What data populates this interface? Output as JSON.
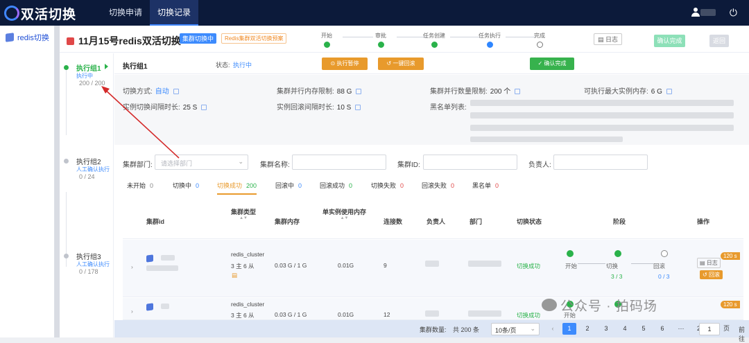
{
  "app": {
    "title": "双活切换"
  },
  "topnav": {
    "tabs": [
      {
        "label": "切换申请"
      },
      {
        "label": "切换记录"
      }
    ]
  },
  "sidebar": {
    "items": [
      {
        "label": "redis切换"
      }
    ]
  },
  "header": {
    "title": "11月15号redis双活切换",
    "badge_type": "集群切换中",
    "badge_plan": "Redis集群双活切换预案",
    "steps": [
      {
        "label": "开始"
      },
      {
        "label": "审批"
      },
      {
        "label": "任务创建"
      },
      {
        "label": "任务执行"
      },
      {
        "label": "完成"
      }
    ],
    "log_label": "日志",
    "confirm_label": "确认完成",
    "back_label": "返回"
  },
  "groups": [
    {
      "name": "执行组1",
      "status": "执行中",
      "count": "200 / 200"
    },
    {
      "name": "执行组2",
      "status": "人工确认执行",
      "count": "0 / 24"
    },
    {
      "name": "执行组3",
      "status": "人工确认执行",
      "count": "0 / 178"
    }
  ],
  "group_bar": {
    "name": "执行组1",
    "status_label": "状态:",
    "status_value": "执行中",
    "pause_label": "执行暂停",
    "rollback_label": "一键回滚",
    "confirm_label": "确认完成"
  },
  "config": {
    "mode_label": "切换方式:",
    "mode_value": "自动",
    "concurrency_label": "集群并行内存限制:",
    "concurrency_value": "88 G",
    "parallel_label": "集群并行数量限制:",
    "parallel_value": "200 个",
    "maxmem_label": "可执行最大实例内存:",
    "maxmem_value": "6 G",
    "switch_interval_label": "实例切换间隔时长:",
    "switch_interval_value": "25 S",
    "rollback_interval_label": "实例回滚间隔时长:",
    "rollback_interval_value": "10 S",
    "blacklist_label": "黑名单列表:"
  },
  "filters": {
    "dept_label": "集群部门:",
    "dept_placeholder": "请选择部门",
    "name_label": "集群名称:",
    "id_label": "集群ID:",
    "owner_label": "负责人:"
  },
  "status_tabs": [
    {
      "label": "未开始",
      "count": "0"
    },
    {
      "label": "切换中",
      "count": "0"
    },
    {
      "label": "切换成功",
      "count": "200"
    },
    {
      "label": "回滚中",
      "count": "0"
    },
    {
      "label": "回滚成功",
      "count": "0"
    },
    {
      "label": "切换失败",
      "count": "0"
    },
    {
      "label": "回滚失败",
      "count": "0"
    },
    {
      "label": "黑名单",
      "count": "0"
    }
  ],
  "table": {
    "columns": [
      "集群id",
      "集群类型",
      "集群内存",
      "单实例使用内存",
      "连接数",
      "负责人",
      "部门",
      "切换状态",
      "阶段",
      "操作"
    ],
    "rows": [
      {
        "type": "redis_cluster",
        "topology": "3 主 6 从",
        "memory": "0.03 G / 1 G",
        "per_instance": "0.01G",
        "conns": "9",
        "status": "切换成功",
        "stage_start": "开始",
        "stage_switch": "切换",
        "stage_rollback": "回滚",
        "switch_progress": "3 / 3",
        "rollback_progress": "0 / 3",
        "badge": "120 s",
        "log_label": "日志",
        "rollback_label": "回滚"
      },
      {
        "type": "redis_cluster",
        "topology": "3 主 6 从",
        "memory": "0.03 G / 1 G",
        "per_instance": "0.01G",
        "conns": "12",
        "status": "切换成功",
        "stage_start": "开始",
        "badge": "120 s"
      }
    ]
  },
  "pager": {
    "total_label": "集群数量:",
    "total": "共 200 条",
    "page_size": "10条/页",
    "pages": [
      "1",
      "2",
      "3",
      "4",
      "5",
      "6",
      "···",
      "20"
    ],
    "goto_label": "前往",
    "goto_value": "1",
    "page_suffix": "页"
  },
  "watermark": "公众号 · 拍码场",
  "colors": {
    "topbar": "#0c1a3a",
    "accent": "#3d8bfd",
    "success": "#2ab24a",
    "warning": "#e89a2c",
    "annotation_arrow": "#d42a2a"
  }
}
